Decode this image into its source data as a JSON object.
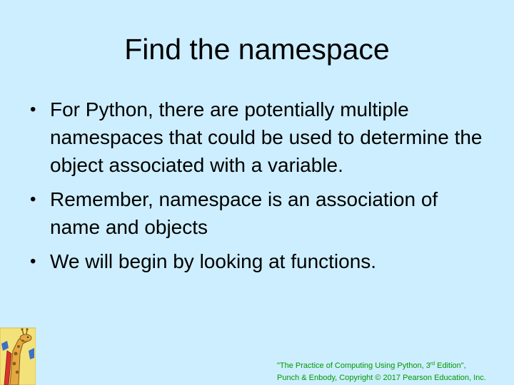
{
  "slide": {
    "title": "Find the namespace",
    "bullets": [
      "For Python, there are potentially multiple namespaces that could be used to determine the object associated with a variable.",
      "Remember, namespace is an association of name and objects",
      "We will begin by looking at functions."
    ],
    "bullet_glyph": "•",
    "footer": {
      "line1_start": "\"The Practice of Computing Using Python, 3",
      "line1_sup": "rd",
      "line1_end": " Edition\",",
      "line2": "Punch & Enbody, Copyright © 2017 Pearson Education, Inc."
    },
    "logo_icon": "giraffe-logo-icon"
  },
  "colors": {
    "background": "#cdeefe",
    "text": "#000000",
    "footer": "#009900"
  }
}
